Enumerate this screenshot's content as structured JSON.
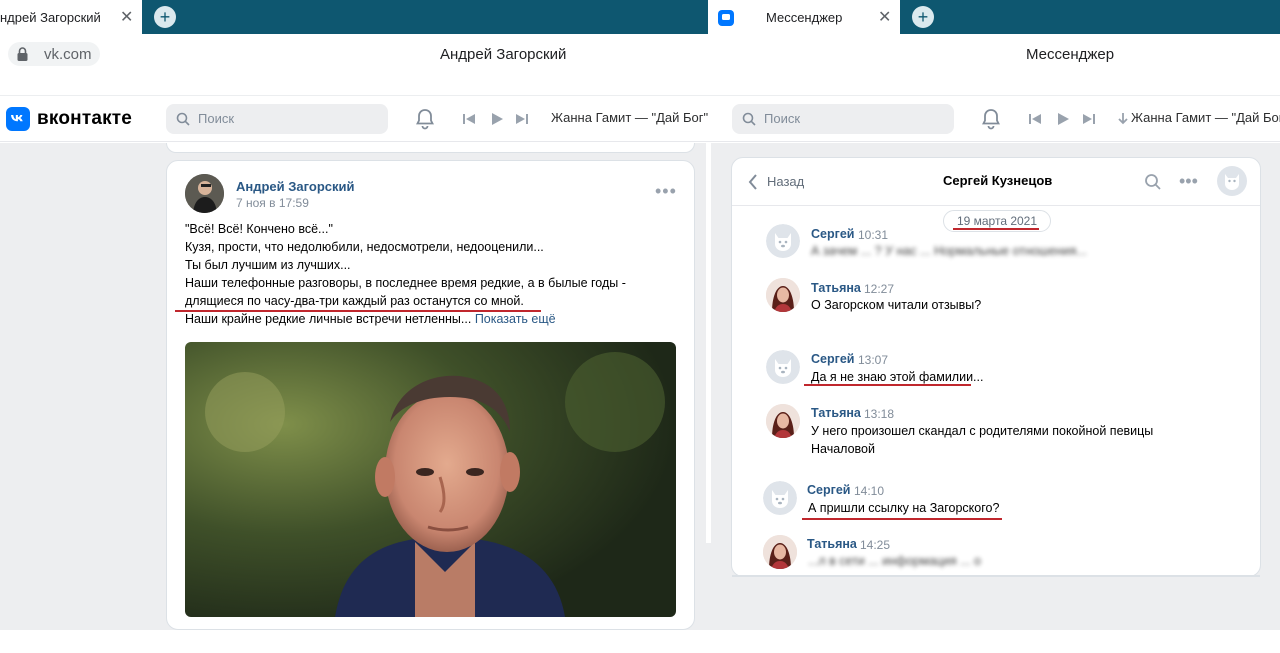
{
  "left_window": {
    "tab_title": "ндрей Загорский",
    "url": "vk.com",
    "page_title": "Андрей Загорский"
  },
  "right_window": {
    "tab_title": "Мессенджер",
    "page_title": "Мессенджер"
  },
  "vk": {
    "logo_text": "вконтакте",
    "search_placeholder": "Поиск",
    "player_track_left": "Жанна Гамит — \"Дай Бог\"",
    "player_track_right": "Жанна Гамит — \"Дай Бог\""
  },
  "post": {
    "author": "Андрей Загорский",
    "date": "7 ноя в 17:59",
    "lines": [
      "\"Всё! Всё! Кончено всё...\"",
      "Кузя, прости, что недолюбили, недосмотрели, недооценили...",
      "Ты был лучшим из лучших...",
      "Наши телефонные разговоры, в последнее время редкие, а в былые годы -",
      "длящиеся по часу-два-три каждый раз останутся со мной.",
      "Наши крайне редкие личные встречи нетленны..."
    ],
    "show_more": "Показать ещё"
  },
  "chat": {
    "back_label": "Назад",
    "title": "Сергей Кузнецов",
    "date_pill": "19 марта 2021",
    "messages": [
      {
        "name": "Сергей",
        "time": "10:31",
        "text": "А зачем ... ? У нас ... Нормальные отношения..."
      },
      {
        "name": "Татьяна",
        "time": "12:27",
        "text": "О Загорском читали отзывы?"
      },
      {
        "name": "Сергей",
        "time": "13:07",
        "text": "Да я не знаю этой фамилии..."
      },
      {
        "name": "Татьяна",
        "time": "13:18",
        "text": "У него произошел скандал с родителями покойной певицы",
        "text2": "Началовой"
      },
      {
        "name": "Сергей",
        "time": "14:10",
        "text": "А пришли ссылку на Загорского?"
      },
      {
        "name": "Татьяна",
        "time": "14:25",
        "text": "...л в сети ... информация ... о"
      }
    ]
  },
  "colors": {
    "browser_tabbar": "#0e5770",
    "vk_blue": "#0077ff",
    "link": "#2a5885",
    "highlight_underline": "#c0272d",
    "page_bg": "#edeef0"
  }
}
